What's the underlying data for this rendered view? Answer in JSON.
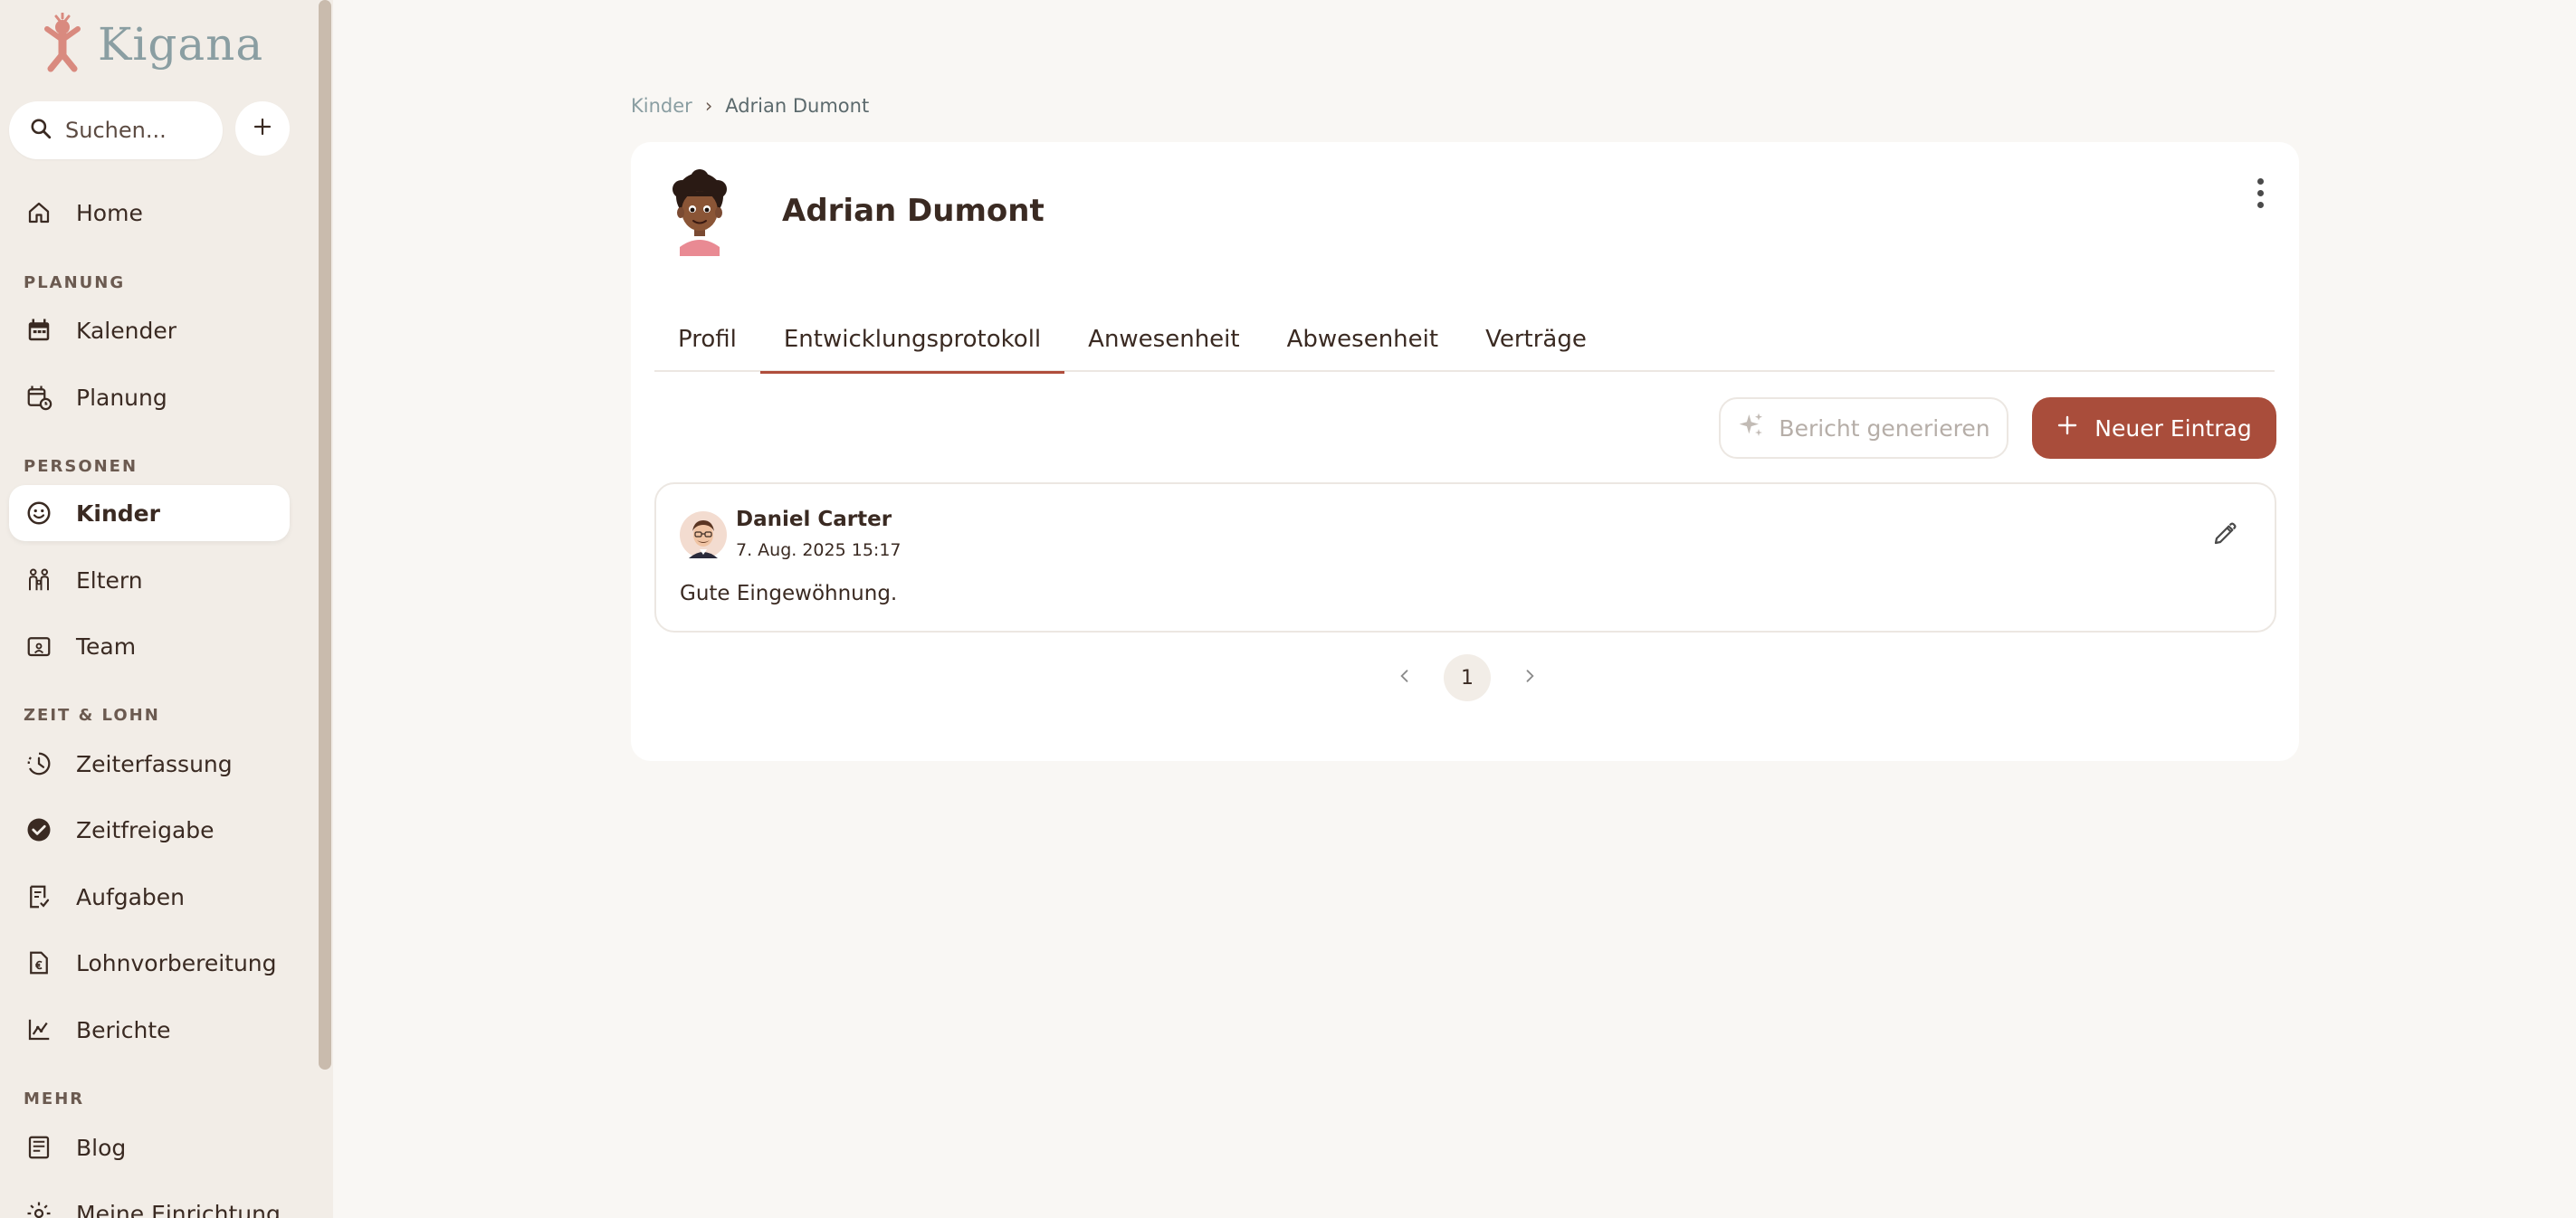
{
  "app": {
    "brand": "Kigana",
    "colors": {
      "accent": "#a94d3b",
      "sidebar_bg": "#f2ede7",
      "page_bg": "#f9f7f4",
      "logo": "#8a9ea2"
    }
  },
  "sidebar": {
    "search_placeholder": "Suchen...",
    "add_icon": "plus-icon",
    "sections": {
      "planung": "PLANUNG",
      "personen": "PERSONEN",
      "zeit_lohn": "ZEIT & LOHN",
      "mehr": "MEHR"
    },
    "items": {
      "home": "Home",
      "kalender": "Kalender",
      "planung": "Planung",
      "kinder": "Kinder",
      "eltern": "Eltern",
      "team": "Team",
      "zeiterfassung": "Zeiterfassung",
      "zeitfreigabe": "Zeitfreigabe",
      "aufgaben": "Aufgaben",
      "lohnvorbereitung": "Lohnvorbereitung",
      "berichte": "Berichte",
      "blog": "Blog",
      "einrichtung": "Meine Einrichtung"
    },
    "active": "kinder"
  },
  "breadcrumb": {
    "parent": "Kinder",
    "separator": "›",
    "current": "Adrian Dumont"
  },
  "child": {
    "name": "Adrian Dumont"
  },
  "tabs": {
    "profil": "Profil",
    "entwicklungsprotokoll": "Entwicklungsprotokoll",
    "anwesenheit": "Anwesenheit",
    "abwesenheit": "Abwesenheit",
    "vertraege": "Verträge",
    "active": "entwicklungsprotokoll"
  },
  "actions": {
    "report": "Bericht generieren",
    "new_entry": "Neuer Eintrag"
  },
  "entries": [
    {
      "author": "Daniel Carter",
      "date": "7. Aug. 2025 15:17",
      "text": "Gute Eingewöhnung."
    }
  ],
  "pagination": {
    "current_page": "1"
  }
}
